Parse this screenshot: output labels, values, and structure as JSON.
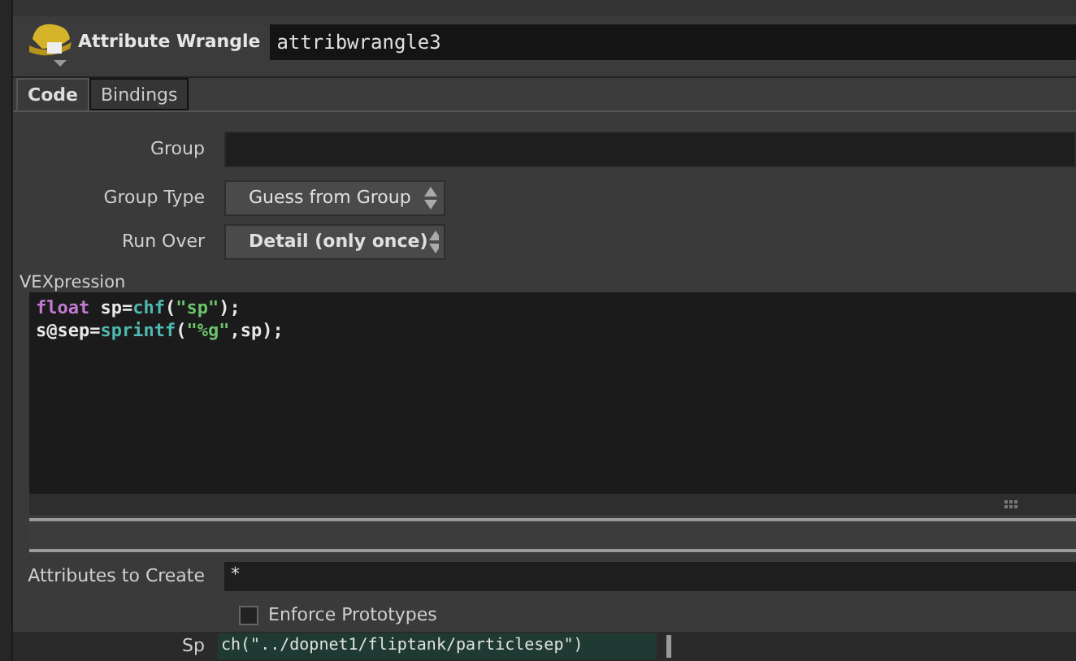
{
  "node": {
    "type_label": "Attribute Wrangle",
    "name": "attribwrangle3"
  },
  "tabs": [
    {
      "label": "Code",
      "selected": true
    },
    {
      "label": "Bindings",
      "selected": false
    }
  ],
  "parameters": [
    {
      "kind": "field",
      "label": "Group"
    },
    {
      "kind": "menu",
      "label": "Group Type",
      "value": "Guess from Group",
      "bold": false
    },
    {
      "kind": "menu",
      "label": "Run Over",
      "value": "Detail (only once)",
      "bold": true
    }
  ],
  "vexpression": {
    "label": "VEXpression",
    "lines": [
      [
        {
          "t": "float",
          "kind": "keyword"
        },
        {
          "t": " sp=",
          "kind": "plain"
        },
        {
          "t": "chf",
          "kind": "func"
        },
        {
          "t": "(",
          "kind": "plain"
        },
        {
          "t": "\"sp\"",
          "kind": "string"
        },
        {
          "t": ");",
          "kind": "plain"
        }
      ],
      [
        {
          "t": "s@sep=",
          "kind": "plain"
        },
        {
          "t": "sprintf",
          "kind": "func"
        },
        {
          "t": "(",
          "kind": "plain"
        },
        {
          "t": "\"%g\"",
          "kind": "string"
        },
        {
          "t": ",sp);",
          "kind": "plain"
        }
      ]
    ]
  },
  "attributes_to_create": {
    "label": "Attributes to Create",
    "value": "*"
  },
  "enforce_prototypes": {
    "label": "Enforce Prototypes",
    "checked": false
  },
  "spare": {
    "label": "Sp",
    "value": "ch(\"../dopnet1/fliptank/particlesep\")"
  }
}
